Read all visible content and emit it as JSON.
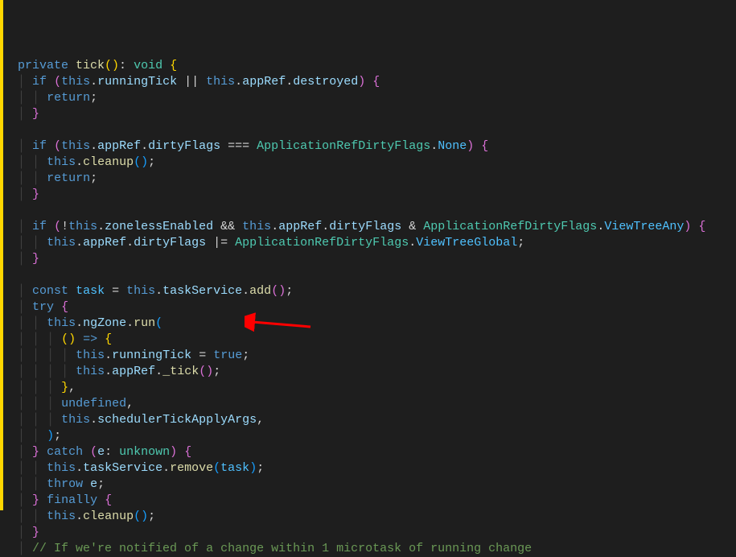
{
  "code": {
    "lines": [
      {
        "indent": 0,
        "tokens": [
          {
            "t": "private ",
            "c": "kw"
          },
          {
            "t": "tick",
            "c": "fn"
          },
          {
            "t": "()",
            "c": "paren3"
          },
          {
            "t": ": ",
            "c": "punct"
          },
          {
            "t": "void",
            "c": "type"
          },
          {
            "t": " ",
            "c": "punct"
          },
          {
            "t": "{",
            "c": "paren3"
          }
        ]
      },
      {
        "indent": 1,
        "tokens": [
          {
            "t": "if",
            "c": "kw"
          },
          {
            "t": " ",
            "c": "punct"
          },
          {
            "t": "(",
            "c": "paren"
          },
          {
            "t": "this",
            "c": "kw"
          },
          {
            "t": ".",
            "c": "punct"
          },
          {
            "t": "runningTick",
            "c": "prop"
          },
          {
            "t": " || ",
            "c": "op"
          },
          {
            "t": "this",
            "c": "kw"
          },
          {
            "t": ".",
            "c": "punct"
          },
          {
            "t": "appRef",
            "c": "prop"
          },
          {
            "t": ".",
            "c": "punct"
          },
          {
            "t": "destroyed",
            "c": "prop"
          },
          {
            "t": ")",
            "c": "paren"
          },
          {
            "t": " ",
            "c": "punct"
          },
          {
            "t": "{",
            "c": "paren"
          }
        ]
      },
      {
        "indent": 2,
        "tokens": [
          {
            "t": "return",
            "c": "kw"
          },
          {
            "t": ";",
            "c": "punct"
          }
        ]
      },
      {
        "indent": 1,
        "tokens": [
          {
            "t": "}",
            "c": "paren"
          }
        ]
      },
      {
        "indent": 0,
        "tokens": []
      },
      {
        "indent": 1,
        "tokens": [
          {
            "t": "if",
            "c": "kw"
          },
          {
            "t": " ",
            "c": "punct"
          },
          {
            "t": "(",
            "c": "paren"
          },
          {
            "t": "this",
            "c": "kw"
          },
          {
            "t": ".",
            "c": "punct"
          },
          {
            "t": "appRef",
            "c": "prop"
          },
          {
            "t": ".",
            "c": "punct"
          },
          {
            "t": "dirtyFlags",
            "c": "prop"
          },
          {
            "t": " === ",
            "c": "op"
          },
          {
            "t": "ApplicationRefDirtyFlags",
            "c": "type"
          },
          {
            "t": ".",
            "c": "punct"
          },
          {
            "t": "None",
            "c": "const"
          },
          {
            "t": ")",
            "c": "paren"
          },
          {
            "t": " ",
            "c": "punct"
          },
          {
            "t": "{",
            "c": "paren"
          }
        ]
      },
      {
        "indent": 2,
        "tokens": [
          {
            "t": "this",
            "c": "kw"
          },
          {
            "t": ".",
            "c": "punct"
          },
          {
            "t": "cleanup",
            "c": "fn"
          },
          {
            "t": "()",
            "c": "paren2"
          },
          {
            "t": ";",
            "c": "punct"
          }
        ]
      },
      {
        "indent": 2,
        "tokens": [
          {
            "t": "return",
            "c": "kw"
          },
          {
            "t": ";",
            "c": "punct"
          }
        ]
      },
      {
        "indent": 1,
        "tokens": [
          {
            "t": "}",
            "c": "paren"
          }
        ]
      },
      {
        "indent": 0,
        "tokens": []
      },
      {
        "indent": 1,
        "tokens": [
          {
            "t": "if",
            "c": "kw"
          },
          {
            "t": " ",
            "c": "punct"
          },
          {
            "t": "(",
            "c": "paren"
          },
          {
            "t": "!",
            "c": "op"
          },
          {
            "t": "this",
            "c": "kw"
          },
          {
            "t": ".",
            "c": "punct"
          },
          {
            "t": "zonelessEnabled",
            "c": "prop"
          },
          {
            "t": " && ",
            "c": "op"
          },
          {
            "t": "this",
            "c": "kw"
          },
          {
            "t": ".",
            "c": "punct"
          },
          {
            "t": "appRef",
            "c": "prop"
          },
          {
            "t": ".",
            "c": "punct"
          },
          {
            "t": "dirtyFlags",
            "c": "prop"
          },
          {
            "t": " & ",
            "c": "op"
          },
          {
            "t": "ApplicationRefDirtyFlags",
            "c": "type"
          },
          {
            "t": ".",
            "c": "punct"
          },
          {
            "t": "ViewTreeAny",
            "c": "const"
          },
          {
            "t": ")",
            "c": "paren"
          },
          {
            "t": " ",
            "c": "punct"
          },
          {
            "t": "{",
            "c": "paren"
          }
        ]
      },
      {
        "indent": 2,
        "tokens": [
          {
            "t": "this",
            "c": "kw"
          },
          {
            "t": ".",
            "c": "punct"
          },
          {
            "t": "appRef",
            "c": "prop"
          },
          {
            "t": ".",
            "c": "punct"
          },
          {
            "t": "dirtyFlags",
            "c": "prop"
          },
          {
            "t": " |= ",
            "c": "op"
          },
          {
            "t": "ApplicationRefDirtyFlags",
            "c": "type"
          },
          {
            "t": ".",
            "c": "punct"
          },
          {
            "t": "ViewTreeGlobal",
            "c": "const"
          },
          {
            "t": ";",
            "c": "punct"
          }
        ]
      },
      {
        "indent": 1,
        "tokens": [
          {
            "t": "}",
            "c": "paren"
          }
        ]
      },
      {
        "indent": 0,
        "tokens": []
      },
      {
        "indent": 1,
        "tokens": [
          {
            "t": "const",
            "c": "kw"
          },
          {
            "t": " ",
            "c": "punct"
          },
          {
            "t": "task",
            "c": "const"
          },
          {
            "t": " = ",
            "c": "op"
          },
          {
            "t": "this",
            "c": "kw"
          },
          {
            "t": ".",
            "c": "punct"
          },
          {
            "t": "taskService",
            "c": "prop"
          },
          {
            "t": ".",
            "c": "punct"
          },
          {
            "t": "add",
            "c": "fn"
          },
          {
            "t": "()",
            "c": "paren"
          },
          {
            "t": ";",
            "c": "punct"
          }
        ]
      },
      {
        "indent": 1,
        "tokens": [
          {
            "t": "try",
            "c": "kw"
          },
          {
            "t": " ",
            "c": "punct"
          },
          {
            "t": "{",
            "c": "paren"
          }
        ]
      },
      {
        "indent": 2,
        "tokens": [
          {
            "t": "this",
            "c": "kw"
          },
          {
            "t": ".",
            "c": "punct"
          },
          {
            "t": "ngZone",
            "c": "prop"
          },
          {
            "t": ".",
            "c": "punct"
          },
          {
            "t": "run",
            "c": "fn"
          },
          {
            "t": "(",
            "c": "paren2"
          }
        ]
      },
      {
        "indent": 3,
        "tokens": [
          {
            "t": "()",
            "c": "paren3"
          },
          {
            "t": " ",
            "c": "punct"
          },
          {
            "t": "=>",
            "c": "kw"
          },
          {
            "t": " ",
            "c": "punct"
          },
          {
            "t": "{",
            "c": "paren3"
          }
        ]
      },
      {
        "indent": 4,
        "tokens": [
          {
            "t": "this",
            "c": "kw"
          },
          {
            "t": ".",
            "c": "punct"
          },
          {
            "t": "runningTick",
            "c": "prop"
          },
          {
            "t": " = ",
            "c": "op"
          },
          {
            "t": "true",
            "c": "kw"
          },
          {
            "t": ";",
            "c": "punct"
          }
        ]
      },
      {
        "indent": 4,
        "tokens": [
          {
            "t": "this",
            "c": "kw"
          },
          {
            "t": ".",
            "c": "punct"
          },
          {
            "t": "appRef",
            "c": "prop"
          },
          {
            "t": ".",
            "c": "punct"
          },
          {
            "t": "_tick",
            "c": "fn"
          },
          {
            "t": "()",
            "c": "paren"
          },
          {
            "t": ";",
            "c": "punct"
          }
        ]
      },
      {
        "indent": 3,
        "tokens": [
          {
            "t": "}",
            "c": "paren3"
          },
          {
            "t": ",",
            "c": "punct"
          }
        ]
      },
      {
        "indent": 3,
        "tokens": [
          {
            "t": "undefined",
            "c": "kw"
          },
          {
            "t": ",",
            "c": "punct"
          }
        ]
      },
      {
        "indent": 3,
        "tokens": [
          {
            "t": "this",
            "c": "kw"
          },
          {
            "t": ".",
            "c": "punct"
          },
          {
            "t": "schedulerTickApplyArgs",
            "c": "prop"
          },
          {
            "t": ",",
            "c": "punct"
          }
        ]
      },
      {
        "indent": 2,
        "tokens": [
          {
            "t": ")",
            "c": "paren2"
          },
          {
            "t": ";",
            "c": "punct"
          }
        ]
      },
      {
        "indent": 1,
        "tokens": [
          {
            "t": "}",
            "c": "paren"
          },
          {
            "t": " ",
            "c": "punct"
          },
          {
            "t": "catch",
            "c": "kw"
          },
          {
            "t": " ",
            "c": "punct"
          },
          {
            "t": "(",
            "c": "paren"
          },
          {
            "t": "e",
            "c": "var"
          },
          {
            "t": ": ",
            "c": "punct"
          },
          {
            "t": "unknown",
            "c": "type"
          },
          {
            "t": ")",
            "c": "paren"
          },
          {
            "t": " ",
            "c": "punct"
          },
          {
            "t": "{",
            "c": "paren"
          }
        ]
      },
      {
        "indent": 2,
        "tokens": [
          {
            "t": "this",
            "c": "kw"
          },
          {
            "t": ".",
            "c": "punct"
          },
          {
            "t": "taskService",
            "c": "prop"
          },
          {
            "t": ".",
            "c": "punct"
          },
          {
            "t": "remove",
            "c": "fn"
          },
          {
            "t": "(",
            "c": "paren2"
          },
          {
            "t": "task",
            "c": "const"
          },
          {
            "t": ")",
            "c": "paren2"
          },
          {
            "t": ";",
            "c": "punct"
          }
        ]
      },
      {
        "indent": 2,
        "tokens": [
          {
            "t": "throw",
            "c": "kw"
          },
          {
            "t": " ",
            "c": "punct"
          },
          {
            "t": "e",
            "c": "var"
          },
          {
            "t": ";",
            "c": "punct"
          }
        ]
      },
      {
        "indent": 1,
        "tokens": [
          {
            "t": "}",
            "c": "paren"
          },
          {
            "t": " ",
            "c": "punct"
          },
          {
            "t": "finally",
            "c": "kw"
          },
          {
            "t": " ",
            "c": "punct"
          },
          {
            "t": "{",
            "c": "paren"
          }
        ]
      },
      {
        "indent": 2,
        "tokens": [
          {
            "t": "this",
            "c": "kw"
          },
          {
            "t": ".",
            "c": "punct"
          },
          {
            "t": "cleanup",
            "c": "fn"
          },
          {
            "t": "()",
            "c": "paren2"
          },
          {
            "t": ";",
            "c": "punct"
          }
        ]
      },
      {
        "indent": 1,
        "tokens": [
          {
            "t": "}",
            "c": "paren"
          }
        ]
      },
      {
        "indent": 1,
        "tokens": [
          {
            "t": "// If we're notified of a change within 1 microtask of running change",
            "c": "comment"
          }
        ]
      }
    ]
  },
  "annotation": {
    "arrow_target_line": 19,
    "arrow_color": "#ff0000"
  }
}
